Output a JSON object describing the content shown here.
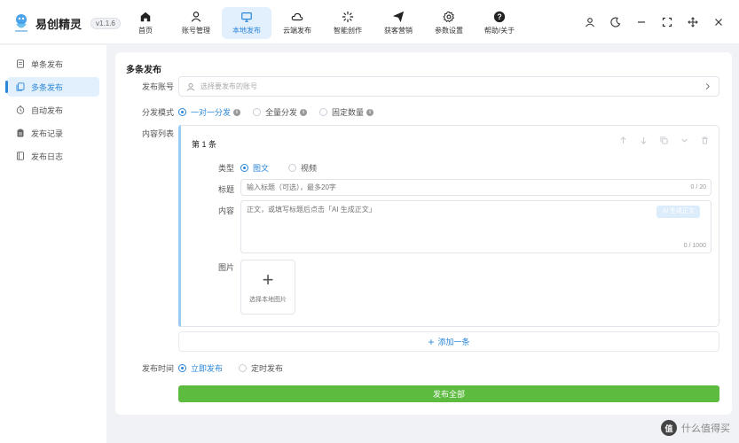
{
  "app": {
    "name": "易创精灵",
    "version": "v1.1.6"
  },
  "nav": [
    {
      "label": "首页",
      "icon": "home-icon"
    },
    {
      "label": "账号管理",
      "icon": "user-icon"
    },
    {
      "label": "本地发布",
      "icon": "monitor-icon",
      "active": true
    },
    {
      "label": "云端发布",
      "icon": "cloud-icon"
    },
    {
      "label": "智能创作",
      "icon": "sparkle-icon"
    },
    {
      "label": "获客营销",
      "icon": "send-icon"
    },
    {
      "label": "参数设置",
      "icon": "gear-icon"
    },
    {
      "label": "帮助/关于",
      "icon": "help-icon"
    }
  ],
  "sidebar": {
    "items": [
      {
        "label": "单条发布",
        "icon": "document-icon"
      },
      {
        "label": "多条发布",
        "icon": "documents-icon",
        "active": true
      },
      {
        "label": "自动发布",
        "icon": "timer-icon"
      },
      {
        "label": "发布记录",
        "icon": "clipboard-icon"
      },
      {
        "label": "发布日志",
        "icon": "book-icon"
      }
    ]
  },
  "main": {
    "title": "多条发布",
    "account": {
      "label": "发布账号",
      "placeholder": "选择要发布的账号"
    },
    "mode": {
      "label": "分发模式",
      "options": [
        "一对一分发",
        "全量分发",
        "固定数量"
      ],
      "selected": "一对一分发"
    },
    "content_list": {
      "label": "内容列表",
      "item_title": "第 1 条",
      "type": {
        "label": "类型",
        "options": [
          "图文",
          "视频"
        ],
        "selected": "图文"
      },
      "title_field": {
        "label": "标题",
        "placeholder": "输入标题（可选），最多20字",
        "counter": "0 / 20"
      },
      "content_field": {
        "label": "内容",
        "placeholder": "正文，或填写标题后点击「AI 生成正文」",
        "counter": "0 / 1000",
        "ai_button": "AI 生成正文"
      },
      "image": {
        "label": "图片",
        "upload_text": "选择本地图片"
      },
      "add_label": "添加一条"
    },
    "publish_time": {
      "label": "发布时间",
      "options": [
        "立即发布",
        "定时发布"
      ],
      "selected": "立即发布"
    },
    "publish_all": "发布全部"
  },
  "watermark": {
    "logo": "值",
    "text": "什么值得买"
  },
  "colors": {
    "accent": "#2c87d8",
    "publish": "#5dbb3f",
    "active_bg": "#e2effc"
  }
}
